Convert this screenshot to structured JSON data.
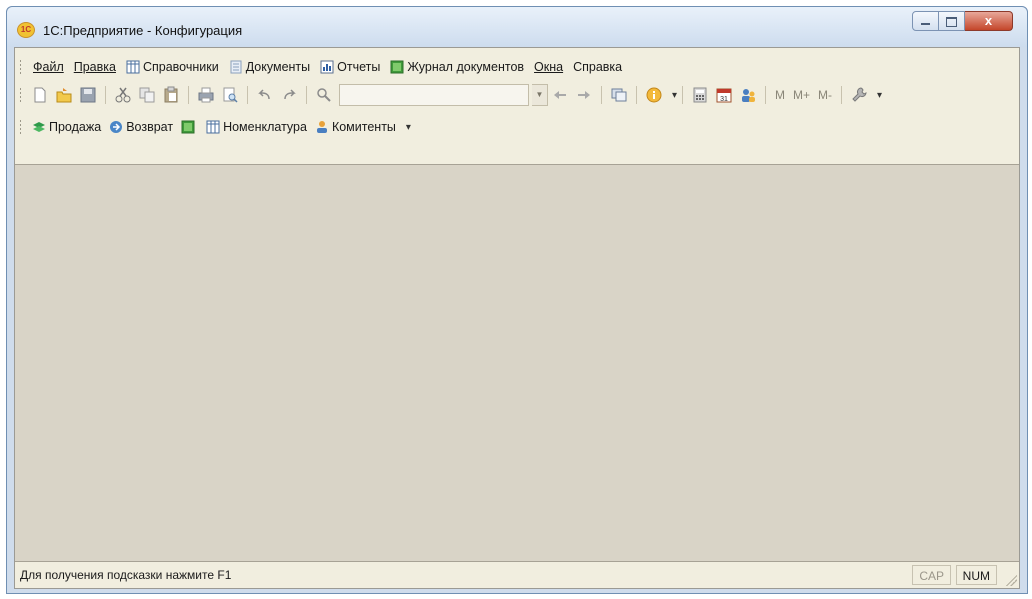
{
  "window": {
    "title": "1С:Предприятие - Конфигурация",
    "app_icon": "1c-logo-icon",
    "close_symbol": "x"
  },
  "menubar": [
    {
      "label": "Файл",
      "icon": null
    },
    {
      "label": "Правка",
      "icon": null
    },
    {
      "label": "Справочники",
      "icon": "table-icon"
    },
    {
      "label": "Документы",
      "icon": "document-icon"
    },
    {
      "label": "Отчеты",
      "icon": "report-icon"
    },
    {
      "label": "Журнал документов",
      "icon": "journal-icon"
    },
    {
      "label": "Окна",
      "icon": null
    },
    {
      "label": "Справка",
      "icon": null
    }
  ],
  "toolbar": {
    "memory_buttons": [
      "M",
      "M+",
      "M-"
    ],
    "search_value": ""
  },
  "quickbar": [
    {
      "label": "Продажа",
      "icon": "sale-icon"
    },
    {
      "label": "Возврат",
      "icon": "return-icon"
    },
    {
      "label": "",
      "icon": "journal-green-icon"
    },
    {
      "label": "Номенклатура",
      "icon": "table-icon"
    },
    {
      "label": "Комитенты",
      "icon": "user-icon"
    }
  ],
  "statusbar": {
    "hint": "Для получения подсказки нажмите F1",
    "cap": "CAP",
    "num": "NUM"
  },
  "colors": {
    "workspace": "#d9d4c7",
    "bars": "#f1eedf",
    "title_bar": "#cddcee",
    "close_button": "#c4462a"
  }
}
